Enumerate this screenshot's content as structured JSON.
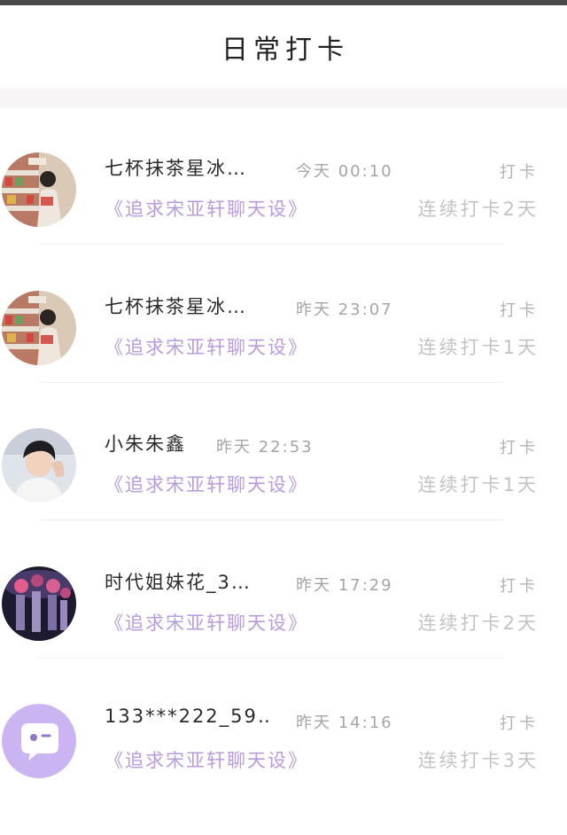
{
  "header": {
    "title": "日常打卡"
  },
  "items": [
    {
      "username": "七杯抹茶星冰…",
      "time": "今天 00:10",
      "checkin": "打卡",
      "book": "《追求宋亚轩聊天设》",
      "streak": "连续打卡2天",
      "avatar_icon": "store-photo-avatar-icon"
    },
    {
      "username": "七杯抹茶星冰…",
      "time": "昨天 23:07",
      "checkin": "打卡",
      "book": "《追求宋亚轩聊天设》",
      "streak": "连续打卡1天",
      "avatar_icon": "store-photo-avatar-icon"
    },
    {
      "username": "小朱朱鑫",
      "time": "昨天 22:53",
      "checkin": "打卡",
      "book": "《追求宋亚轩聊天设》",
      "streak": "连续打卡1天",
      "avatar_icon": "boy-photo-avatar-icon"
    },
    {
      "username": "时代姐妹花_3…",
      "time": "昨天 17:29",
      "checkin": "打卡",
      "book": "《追求宋亚轩聊天设》",
      "streak": "连续打卡2天",
      "avatar_icon": "group-photo-avatar-icon"
    },
    {
      "username": "133***222_59…",
      "time": "昨天 14:16",
      "checkin": "打卡",
      "book": "《追求宋亚轩聊天设》",
      "streak": "连续打卡3天",
      "avatar_icon": "chat-bubble-avatar-icon"
    }
  ],
  "colors": {
    "book_link": "#b99be0",
    "muted": "#a5a5a5",
    "default_avatar_bg": "#cbb4f2"
  }
}
